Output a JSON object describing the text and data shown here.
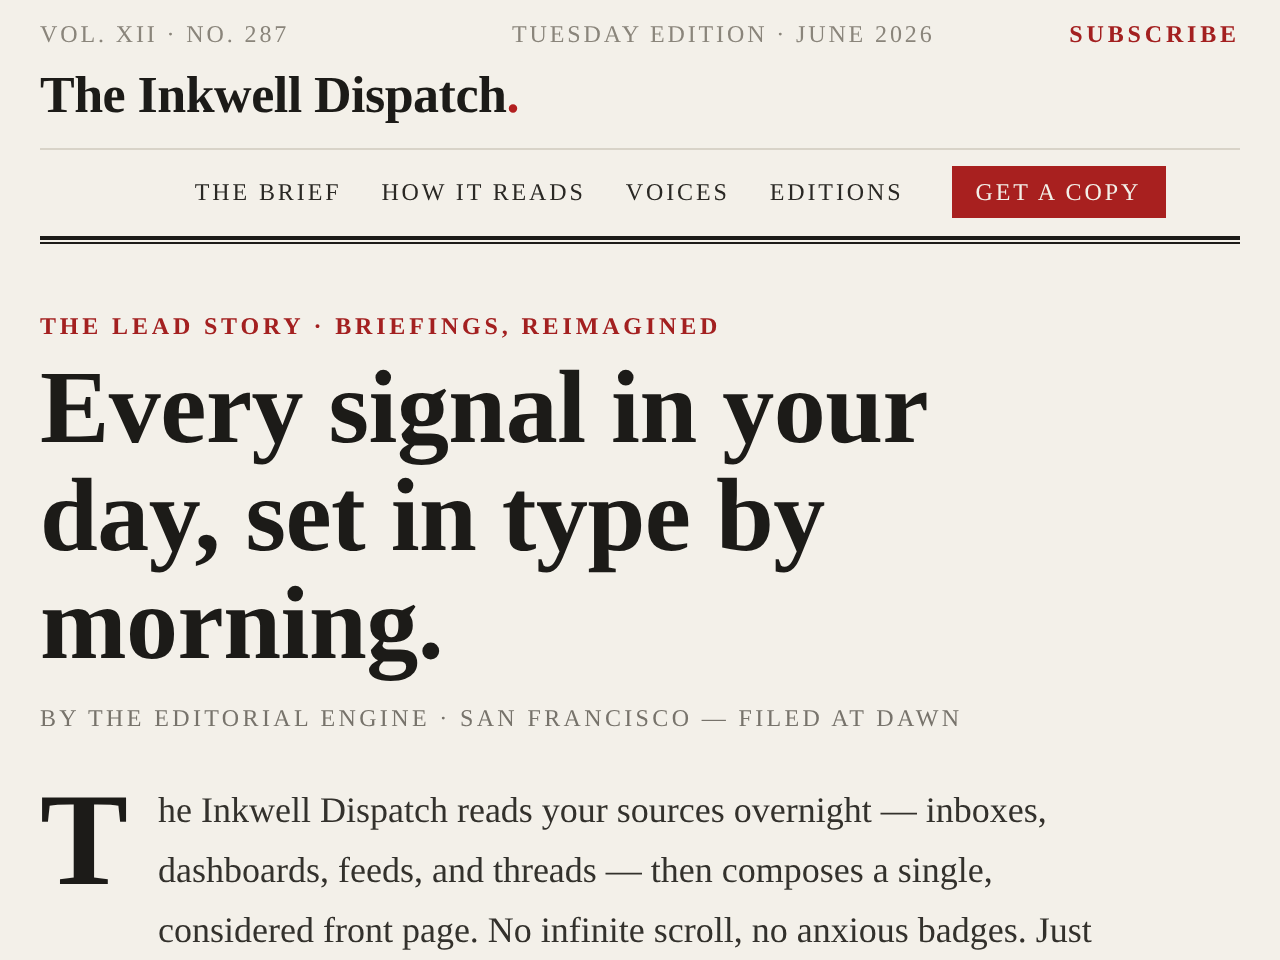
{
  "masthead": {
    "volume": "VOL. XII · NO. 287",
    "edition": "TUESDAY EDITION · JUNE 2026",
    "subscribe": "SUBSCRIBE",
    "wordmark": "The Inkwell Dispatch",
    "wordmark_dot": "."
  },
  "nav": {
    "items": [
      {
        "label": "THE BRIEF",
        "kind": "link"
      },
      {
        "label": "HOW IT READS",
        "kind": "link"
      },
      {
        "label": "VOICES",
        "kind": "link"
      },
      {
        "label": "EDITIONS",
        "kind": "link"
      },
      {
        "label": "GET A COPY",
        "kind": "button"
      }
    ]
  },
  "story": {
    "kicker": "THE LEAD STORY · BRIEFINGS, REIMAGINED",
    "headline": "Every signal in your day, set in type by morning.",
    "byline": "BY THE EDITORIAL ENGINE · SAN FRANCISCO — FILED AT DAWN",
    "drop_cap": "T",
    "lines": [
      "he Inkwell Dispatch reads your sources overnight — inboxes,",
      "dashboards, feeds, and threads — then composes a single,",
      "considered front page. No infinite scroll, no anxious badges. Just"
    ]
  }
}
